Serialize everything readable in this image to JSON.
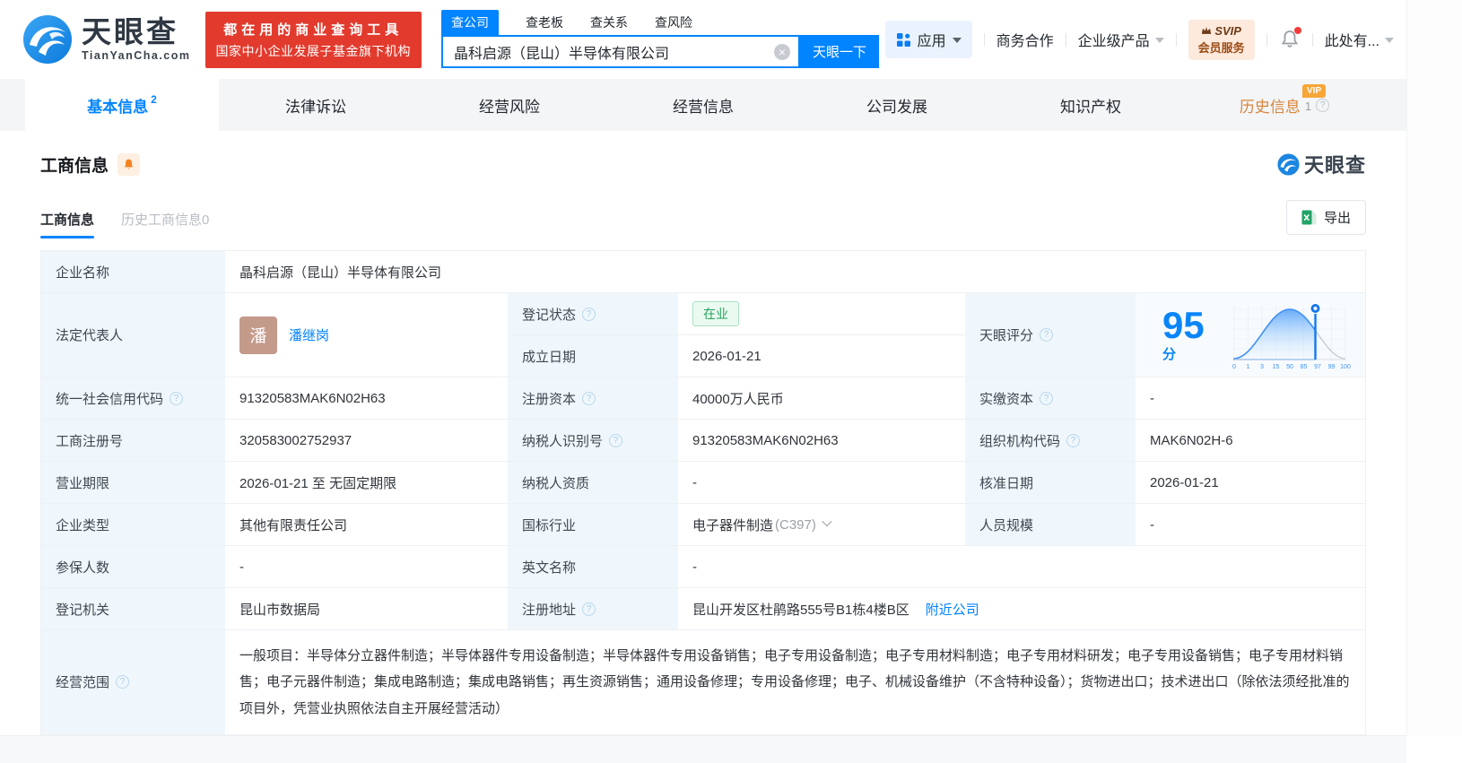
{
  "brand": {
    "primary_color": "#0084ff",
    "red": "#e23b2e",
    "orange": "#d9853a"
  },
  "header": {
    "logo": {
      "title": "天眼查",
      "subtitle": "TianYanCha.com"
    },
    "slogan": {
      "line1": "都在用的商业查询工具",
      "line2": "国家中小企业发展子基金旗下机构"
    },
    "search": {
      "tabs": [
        {
          "label": "查公司",
          "active": true
        },
        {
          "label": "查老板",
          "active": false
        },
        {
          "label": "查关系",
          "active": false
        },
        {
          "label": "查风险",
          "active": false
        }
      ],
      "value": "晶科启源（昆山）半导体有限公司",
      "button": "天眼一下"
    },
    "menu": {
      "apps": "应用",
      "business_cooperation": "商务合作",
      "enterprise_products": "企业级产品",
      "svip_top": "SVIP",
      "svip_bottom": "会员服务",
      "user": "此处有..."
    }
  },
  "nav_tabs": [
    {
      "label": "基本信息",
      "count": "2",
      "active": true
    },
    {
      "label": "法律诉讼"
    },
    {
      "label": "经营风险"
    },
    {
      "label": "经营信息"
    },
    {
      "label": "公司发展"
    },
    {
      "label": "知识产权"
    },
    {
      "label": "历史信息",
      "count": "1",
      "vip": "VIP"
    }
  ],
  "section": {
    "title": "工商信息",
    "watermark": "天眼查",
    "subtabs": [
      {
        "label": "工商信息",
        "active": true
      },
      {
        "label": "历史工商信息0",
        "active": false
      }
    ],
    "export_label": "导出"
  },
  "table": {
    "company_name": {
      "label": "企业名称",
      "value": "晶科启源（昆山）半导体有限公司"
    },
    "legal_rep": {
      "label": "法定代表人",
      "avatar": "潘",
      "name": "潘继岗"
    },
    "reg_status": {
      "label": "登记状态",
      "value": "在业"
    },
    "establish_date": {
      "label": "成立日期",
      "value": "2026-01-21"
    },
    "score": {
      "label": "天眼评分",
      "value": "95",
      "unit": "分",
      "ticks": [
        "0",
        "1",
        "3",
        "15",
        "50",
        "85",
        "97",
        "99",
        "100"
      ]
    },
    "credit_code": {
      "label": "统一社会信用代码",
      "value": "91320583MAK6N02H63"
    },
    "reg_capital": {
      "label": "注册资本",
      "value": "40000万人民币"
    },
    "paid_capital": {
      "label": "实缴资本",
      "value": "-"
    },
    "reg_number": {
      "label": "工商注册号",
      "value": "320583002752937"
    },
    "taxpayer_id": {
      "label": "纳税人识别号",
      "value": "91320583MAK6N02H63"
    },
    "org_code": {
      "label": "组织机构代码",
      "value": "MAK6N02H-6"
    },
    "business_term": {
      "label": "营业期限",
      "value": "2026-01-21 至 无固定期限"
    },
    "taxpayer_quality": {
      "label": "纳税人资质",
      "value": "-"
    },
    "approval_date": {
      "label": "核准日期",
      "value": "2026-01-21"
    },
    "company_type": {
      "label": "企业类型",
      "value": "其他有限责任公司"
    },
    "industry": {
      "label": "国标行业",
      "value": "电子器件制造",
      "code": "(C397)"
    },
    "staff_size": {
      "label": "人员规模",
      "value": "-"
    },
    "insured_count": {
      "label": "参保人数",
      "value": "-"
    },
    "english_name": {
      "label": "英文名称",
      "value": "-"
    },
    "reg_authority": {
      "label": "登记机关",
      "value": "昆山市数据局"
    },
    "reg_address": {
      "label": "注册地址",
      "value": "昆山开发区杜鹃路555号B1栋4楼B区",
      "link": "附近公司"
    },
    "business_scope": {
      "label": "经营范围",
      "value": "一般项目：半导体分立器件制造；半导体器件专用设备制造；半导体器件专用设备销售；电子专用设备制造；电子专用材料制造；电子专用材料研发；电子专用设备销售；电子专用材料销售；电子元器件制造；集成电路制造；集成电路销售；再生资源销售；通用设备修理；专用设备修理；电子、机械设备维护（不含特种设备）；货物进出口；技术进出口（除依法须经批准的项目外，凭营业执照依法自主开展经营活动）"
    }
  },
  "chart_data": {
    "type": "area",
    "title": "天眼评分分布曲线",
    "x_tick_labels": [
      "0",
      "1",
      "3",
      "15",
      "50",
      "85",
      "97",
      "99",
      "100"
    ],
    "marker_value": 95,
    "score": 95,
    "note": "bell-shaped score distribution, blue filled left of marker pin at 95, gray tail right of marker"
  }
}
